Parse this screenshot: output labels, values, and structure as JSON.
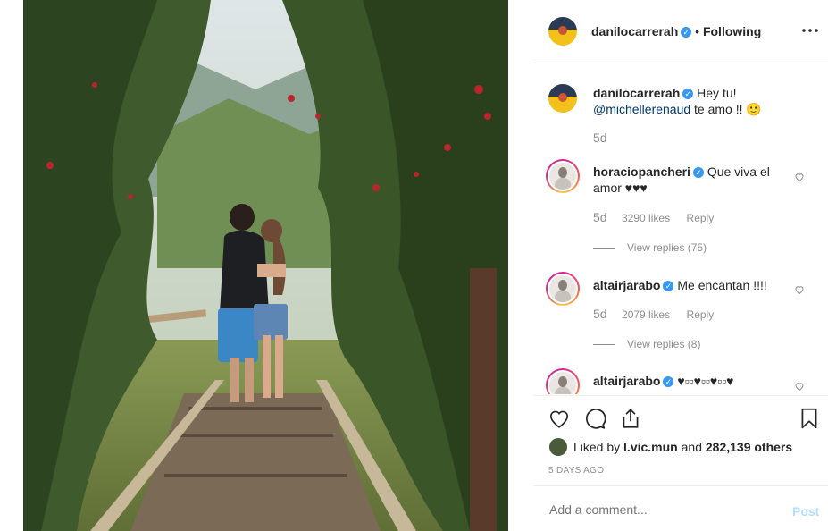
{
  "post": {
    "owner": {
      "username": "danilocarrerah",
      "follow_status": "Following",
      "dot": "•"
    },
    "menu_icon": "more-horizontal-icon",
    "caption": {
      "username": "danilocarrerah",
      "text_before": "Hey tu!",
      "mention": "@michellerenaud",
      "text_after": "te amo !! 🙂",
      "time": "5d"
    },
    "comments": [
      {
        "username": "horaciopancheri",
        "text": "Que viva el amor ♥♥♥",
        "time": "5d",
        "likes": "3290 likes",
        "reply": "Reply",
        "view_replies": "View replies (75)"
      },
      {
        "username": "altairjarabo",
        "text": "Me encantan !!!!",
        "time": "5d",
        "likes": "2079 likes",
        "reply": "Reply",
        "view_replies": "View replies (8)"
      },
      {
        "username": "altairjarabo",
        "text": "♥▫▫♥▫▫♥▫▫♥"
      }
    ],
    "liked_by": {
      "prefix": "Liked by",
      "user": "l.vic.mun",
      "middle": "and",
      "count": "282,139 others"
    },
    "timestamp": "5 DAYS AGO",
    "comment_box": {
      "placeholder": "Add a comment...",
      "post_label": "Post"
    }
  },
  "colors": {
    "verified": "#3897f0",
    "mention": "#00376b",
    "muted": "#8e8e8e",
    "post_disabled": "#b2dffc"
  }
}
